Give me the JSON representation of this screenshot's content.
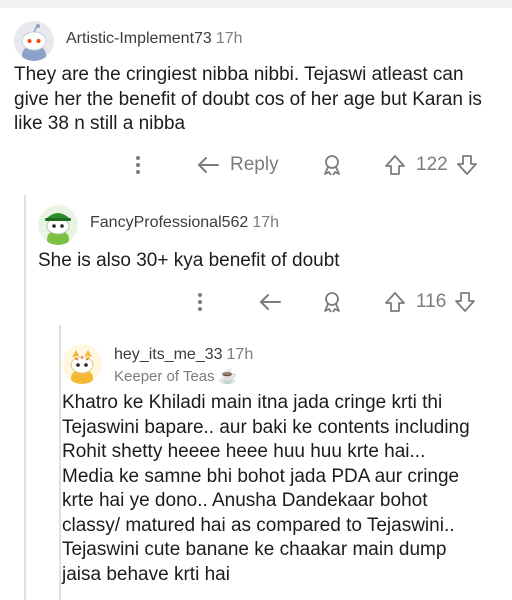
{
  "comments": [
    {
      "author": "Artistic-Implement73",
      "age": "17h",
      "body": "They are the cringiest nibba nibbi. Tejaswi atleast can give her the benefit of doubt cos of her age but Karan is like 38 n still a nibba",
      "reply_label": "Reply",
      "votes": "122"
    },
    {
      "author": "FancyProfessional562",
      "age": "17h",
      "body": "She is also 30+ kya benefit of doubt",
      "votes": "116"
    },
    {
      "author": "hey_its_me_33",
      "age": "17h",
      "flair": "Keeper of Teas ☕",
      "body": "Khatro ke Khiladi main itna jada cringe krti thi Tejaswini bapare.. aur baki ke contents including Rohit shetty heeee heee huu huu krte hai... Media ke samne bhi bohot jada PDA aur cringe krte hai ye dono.. Anusha Dandekaar bohot classy/ matured  hai as compared to Tejaswini.. Tejaswini cute banane ke chaakar main dump jaisa behave krti hai"
    }
  ],
  "icons": {
    "more": "more-vertical-icon",
    "reply": "reply-arrow-icon",
    "award": "award-icon",
    "upvote": "upvote-arrow-icon",
    "downvote": "downvote-arrow-icon"
  },
  "colors": {
    "meta": "#7c7c7c",
    "text": "#1c1c1c",
    "thread": "#e0e0e0"
  }
}
